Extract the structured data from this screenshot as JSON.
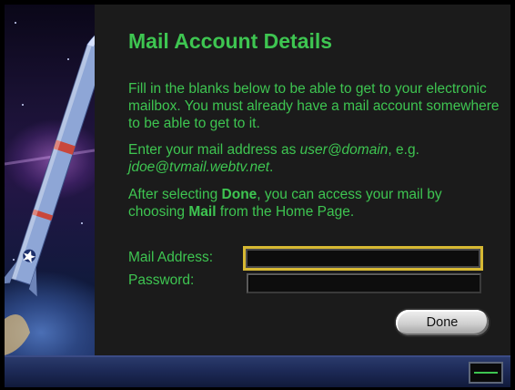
{
  "window": {
    "title": "Mail Account Details"
  },
  "intro": {
    "text": "Fill in the blanks below to be able to get to your electronic mailbox. You must already have a mail account somewhere to be able to get to it."
  },
  "address_hint": {
    "prefix": "Enter your mail address as ",
    "format": "user@domain",
    "middle": ", e.g.",
    "example": "jdoe@tvmail.webtv.net",
    "suffix": "."
  },
  "done_hint": {
    "part1": "After selecting ",
    "done_word": "Done",
    "part2": ", you can access your mail by choosing ",
    "mail_word": "Mail",
    "part3": " from the Home Page."
  },
  "form": {
    "mail_label": "Mail Address:",
    "mail_value": "",
    "password_label": "Password:",
    "password_value": "",
    "done_label": "Done"
  },
  "colors": {
    "text_green": "#3ec551",
    "focus_yellow": "#d7b933",
    "panel_bg": "#1b1b1b",
    "bar_blue": "#1d2a57"
  },
  "icons": {
    "side_art": "rocket-launch-illustration",
    "status": "connection-status-indicator"
  }
}
